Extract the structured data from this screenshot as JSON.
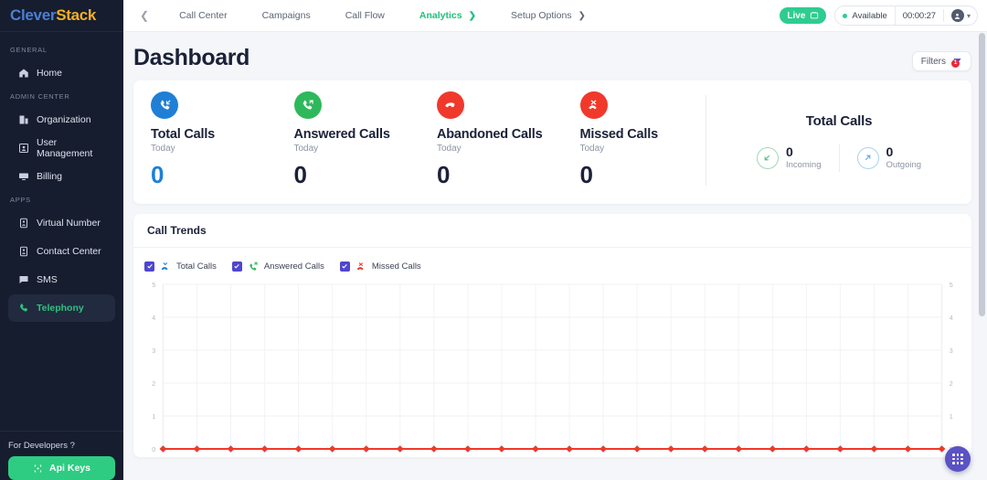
{
  "brand": {
    "part1": "Clever",
    "part2": "Stack"
  },
  "sidebar": {
    "groups": [
      {
        "label": "GENERAL",
        "items": [
          {
            "label": "Home",
            "icon": "home-icon"
          }
        ]
      },
      {
        "label": "ADMIN CENTER",
        "items": [
          {
            "label": "Organization",
            "icon": "organization-icon"
          },
          {
            "label": "User Management",
            "icon": "user-icon"
          },
          {
            "label": "Billing",
            "icon": "billing-icon"
          }
        ]
      },
      {
        "label": "APPS",
        "items": [
          {
            "label": "Virtual Number",
            "icon": "virtual-number-icon"
          },
          {
            "label": "Contact Center",
            "icon": "contact-center-icon"
          },
          {
            "label": "SMS",
            "icon": "sms-icon"
          },
          {
            "label": "Telephony",
            "icon": "phone-icon",
            "active": true
          }
        ]
      }
    ],
    "developers": {
      "label": "For Developers ?",
      "api_button": "Api Keys",
      "api_icon": "api-key-icon"
    },
    "accent_active": "#2ec27e",
    "api_button_color": "#2ecc82"
  },
  "topbar": {
    "back_icon": "chevron-left-icon",
    "nav": [
      {
        "label": "Call Center",
        "active": false,
        "chevron": false
      },
      {
        "label": "Campaigns",
        "active": false,
        "chevron": false
      },
      {
        "label": "Call Flow",
        "active": false,
        "chevron": false
      },
      {
        "label": "Analytics",
        "active": true,
        "chevron": true
      },
      {
        "label": "Setup Options",
        "active": false,
        "chevron": true
      }
    ],
    "live": {
      "label": "Live",
      "icon": "monitor-icon",
      "color": "#2ecc8f"
    },
    "status": {
      "label": "Available",
      "dot_color": "#2ecc8f"
    },
    "timer": "00:00:27",
    "avatar_icon": "user-avatar-icon",
    "avatar_chevron": "chevron-down-icon"
  },
  "page": {
    "title": "Dashboard",
    "filters": {
      "label": "Filters",
      "icon": "funnel-icon",
      "badge": "1",
      "badge_color": "#e8283b",
      "icon_color": "#4a46c9"
    }
  },
  "stats": [
    {
      "title": "Total Calls",
      "sub": "Today",
      "value": "0",
      "icon": "incoming-call-icon",
      "icon_bg": "#1f7fd6",
      "value_color": "#1f7fd6"
    },
    {
      "title": "Answered Calls",
      "sub": "Today",
      "value": "0",
      "icon": "answered-call-icon",
      "icon_bg": "#2eb85c",
      "value_color": "#12182b"
    },
    {
      "title": "Abandoned Calls",
      "sub": "Today",
      "value": "0",
      "icon": "call-end-icon",
      "icon_bg": "#f0392b",
      "value_color": "#12182b"
    },
    {
      "title": "Missed Calls",
      "sub": "Today",
      "value": "0",
      "icon": "missed-call-icon",
      "icon_bg": "#f0392b",
      "value_color": "#12182b"
    }
  ],
  "totals": {
    "title": "Total Calls",
    "items": [
      {
        "value": "0",
        "label": "Incoming",
        "icon": "arrow-down-left-icon",
        "color": "#4fbf7f"
      },
      {
        "value": "0",
        "label": "Outgoing",
        "icon": "arrow-up-right-icon",
        "color": "#5ca9e0"
      }
    ]
  },
  "trends": {
    "title": "Call Trends",
    "legend": [
      {
        "label": "Total Calls",
        "checked": true,
        "icon": "total-calls-icon",
        "color": "#1f7fd6"
      },
      {
        "label": "Answered Calls",
        "checked": true,
        "icon": "answered-call-icon",
        "color": "#2eb85c"
      },
      {
        "label": "Missed Calls",
        "checked": true,
        "icon": "missed-call-icon",
        "color": "#f0392b"
      }
    ],
    "checkbox_color": "#4f46cf"
  },
  "chart_data": {
    "type": "line",
    "title": "Call Trends",
    "xlabel": "",
    "ylabel": "",
    "ylim": [
      0,
      5
    ],
    "y_ticks": [
      0,
      1,
      2,
      3,
      4,
      5
    ],
    "right_y_ticks": [
      0,
      1,
      2,
      3,
      4,
      5
    ],
    "grid": true,
    "legend_position": "top-left",
    "dual_axis": true,
    "x": [
      1,
      2,
      3,
      4,
      5,
      6,
      7,
      8,
      9,
      10,
      11,
      12,
      13,
      14,
      15,
      16,
      17,
      18,
      19,
      20,
      21,
      22,
      23,
      24
    ],
    "x_tick_labels": [],
    "series": [
      {
        "name": "Total Calls",
        "color": "#1f7fd6",
        "values": [
          0,
          0,
          0,
          0,
          0,
          0,
          0,
          0,
          0,
          0,
          0,
          0,
          0,
          0,
          0,
          0,
          0,
          0,
          0,
          0,
          0,
          0,
          0,
          0
        ]
      },
      {
        "name": "Answered Calls",
        "color": "#33b14f",
        "values": [
          0,
          0,
          0,
          0,
          0,
          0,
          0,
          0,
          0,
          0,
          0,
          0,
          0,
          0,
          0,
          0,
          0,
          0,
          0,
          0,
          0,
          0,
          0,
          0
        ]
      },
      {
        "name": "Missed Calls",
        "color": "#f0392b",
        "values": [
          0,
          0,
          0,
          0,
          0,
          0,
          0,
          0,
          0,
          0,
          0,
          0,
          0,
          0,
          0,
          0,
          0,
          0,
          0,
          0,
          0,
          0,
          0,
          0
        ]
      }
    ]
  },
  "fab": {
    "icon": "dialpad-icon",
    "color": "#5b52c4"
  }
}
